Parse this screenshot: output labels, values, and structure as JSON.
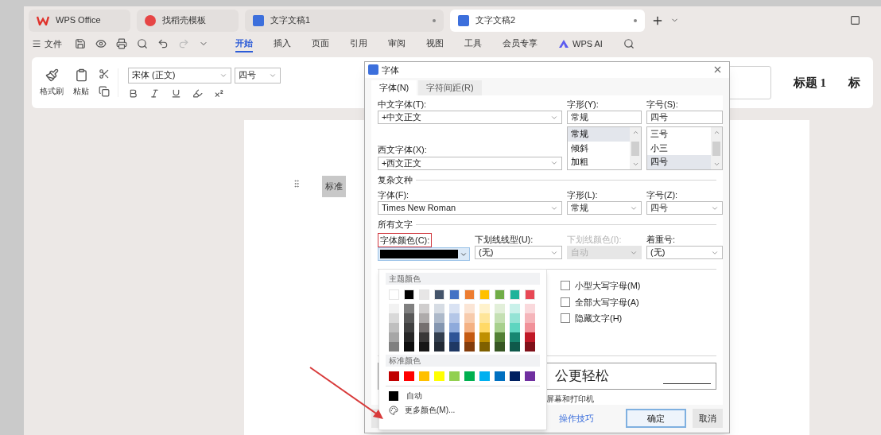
{
  "app_tabs": [
    {
      "kind": "home",
      "label": "WPS Office",
      "selected": false
    },
    {
      "kind": "template",
      "label": "找稻壳模板",
      "selected": false
    },
    {
      "kind": "doc",
      "label": "文字文稿1",
      "selected": false
    },
    {
      "kind": "doc",
      "label": "文字文稿2",
      "selected": true
    }
  ],
  "menu": {
    "file": "文件",
    "ribbon_tabs": [
      {
        "label": "开始",
        "selected": true
      },
      {
        "label": "插入",
        "selected": false
      },
      {
        "label": "页面",
        "selected": false
      },
      {
        "label": "引用",
        "selected": false
      },
      {
        "label": "审阅",
        "selected": false
      },
      {
        "label": "视图",
        "selected": false
      },
      {
        "label": "工具",
        "selected": false
      },
      {
        "label": "会员专享",
        "selected": false
      }
    ],
    "ai": "WPS AI"
  },
  "ribbon": {
    "format_painter": "格式刷",
    "paste": "粘贴",
    "font_name": "宋体 (正文)",
    "font_size": "四号"
  },
  "styles": [
    "标题 1",
    "标"
  ],
  "document": {
    "selected_text": "标准"
  },
  "dialog": {
    "title": "字体",
    "tabs": [
      {
        "label": "字体(N)",
        "selected": true
      },
      {
        "label": "字符间距(R)",
        "selected": false
      }
    ],
    "chinese_font": {
      "label": "中文字体(T):",
      "value": "+中文正文"
    },
    "western_font": {
      "label": "西文字体(X):",
      "value": "+西文正文"
    },
    "style": {
      "label": "字形(Y):",
      "value": "常规",
      "options": [
        {
          "label": "常规",
          "selected": true
        },
        {
          "label": "倾斜",
          "selected": false
        },
        {
          "label": "加粗",
          "selected": false
        }
      ]
    },
    "size": {
      "label": "字号(S):",
      "value": "四号",
      "options": [
        {
          "label": "三号",
          "selected": false
        },
        {
          "label": "小三",
          "selected": false
        },
        {
          "label": "四号",
          "selected": true
        }
      ]
    },
    "complex_section": "复杂文种",
    "complex_font": {
      "label": "字体(F):",
      "value": "Times New Roman"
    },
    "complex_style": {
      "label": "字形(L):",
      "value": "常规"
    },
    "complex_size": {
      "label": "字号(Z):",
      "value": "四号"
    },
    "all_text_section": "所有文字",
    "font_color": {
      "label": "字体颜色(C):",
      "color": "#000000",
      "annotated": true
    },
    "underline_style": {
      "label": "下划线线型(U):",
      "value": "(无)"
    },
    "underline_color": {
      "label": "下划线颜色(I):",
      "value": "自动",
      "disabled": true
    },
    "emphasis": {
      "label": "着重号:",
      "value": "(无)"
    },
    "effects": [
      {
        "label": "小型大写字母(M)",
        "checked": false
      },
      {
        "label": "全部大写字母(A)",
        "checked": false
      },
      {
        "label": "隐藏文字(H)",
        "checked": false
      }
    ],
    "preview_text": "公更轻松",
    "note": "屏幕和打印机",
    "buttons": [
      {
        "kind": "blank"
      },
      {
        "kind": "blank"
      },
      {
        "kind": "link",
        "label": "操作技巧"
      },
      {
        "kind": "primary",
        "label": "确定"
      },
      {
        "kind": "default",
        "label": "取消"
      }
    ]
  },
  "color_menu": {
    "theme_heading": "主题颜色",
    "theme_colors": [
      {
        "color": "#ffffff",
        "shades": [
          {
            "color": "#f2f2f2"
          },
          {
            "color": "#d9d9d9"
          },
          {
            "color": "#bfbfbf"
          },
          {
            "color": "#a6a6a6"
          },
          {
            "color": "#808080"
          }
        ]
      },
      {
        "color": "#000000",
        "shades": [
          {
            "color": "#808080"
          },
          {
            "color": "#595959"
          },
          {
            "color": "#404040"
          },
          {
            "color": "#262626"
          },
          {
            "color": "#0d0d0d"
          }
        ]
      },
      {
        "color": "#e7e6e6",
        "shades": [
          {
            "color": "#d0cece"
          },
          {
            "color": "#aeabab"
          },
          {
            "color": "#757070"
          },
          {
            "color": "#3a3838"
          },
          {
            "color": "#171616"
          }
        ]
      },
      {
        "color": "#44546a",
        "shades": [
          {
            "color": "#d6dce4"
          },
          {
            "color": "#adb9ca"
          },
          {
            "color": "#8496b0"
          },
          {
            "color": "#333f4f"
          },
          {
            "color": "#222a35"
          }
        ]
      },
      {
        "color": "#4472c4",
        "shades": [
          {
            "color": "#d9e2f3"
          },
          {
            "color": "#b4c6e7"
          },
          {
            "color": "#8eaadb"
          },
          {
            "color": "#2f5496"
          },
          {
            "color": "#1f3864"
          }
        ]
      },
      {
        "color": "#ed7d31",
        "shades": [
          {
            "color": "#fbe5d5"
          },
          {
            "color": "#f7cbac"
          },
          {
            "color": "#f4b183"
          },
          {
            "color": "#c55a11"
          },
          {
            "color": "#833c0b"
          }
        ]
      },
      {
        "color": "#ffc000",
        "shades": [
          {
            "color": "#fff2cc"
          },
          {
            "color": "#fee599"
          },
          {
            "color": "#ffd966"
          },
          {
            "color": "#bf9000"
          },
          {
            "color": "#7f6000"
          }
        ]
      },
      {
        "color": "#70ad47",
        "shades": [
          {
            "color": "#e2efd9"
          },
          {
            "color": "#c5e0b3"
          },
          {
            "color": "#a8d08d"
          },
          {
            "color": "#538135"
          },
          {
            "color": "#375623"
          }
        ]
      },
      {
        "color": "#1fb39a",
        "shades": [
          {
            "color": "#c9f1ea"
          },
          {
            "color": "#94e3d5"
          },
          {
            "color": "#5ed5c0"
          },
          {
            "color": "#178671"
          },
          {
            "color": "#0f594b"
          }
        ]
      },
      {
        "color": "#e84855",
        "shades": [
          {
            "color": "#fad9dc"
          },
          {
            "color": "#f5b5ba"
          },
          {
            "color": "#f19199"
          },
          {
            "color": "#c01826"
          },
          {
            "color": "#7f1019"
          }
        ]
      }
    ],
    "standard_heading": "标准颜色",
    "standard_colors": [
      {
        "color": "#c00000"
      },
      {
        "color": "#ff0000"
      },
      {
        "color": "#ffc000"
      },
      {
        "color": "#ffff00"
      },
      {
        "color": "#92d050"
      },
      {
        "color": "#00b050"
      },
      {
        "color": "#00b0f0"
      },
      {
        "color": "#0070c0"
      },
      {
        "color": "#002060"
      },
      {
        "color": "#7030a0"
      }
    ],
    "auto": {
      "label": "自动",
      "color": "#000000"
    },
    "more": "更多颜色(M)..."
  },
  "annotation_arrow": true
}
